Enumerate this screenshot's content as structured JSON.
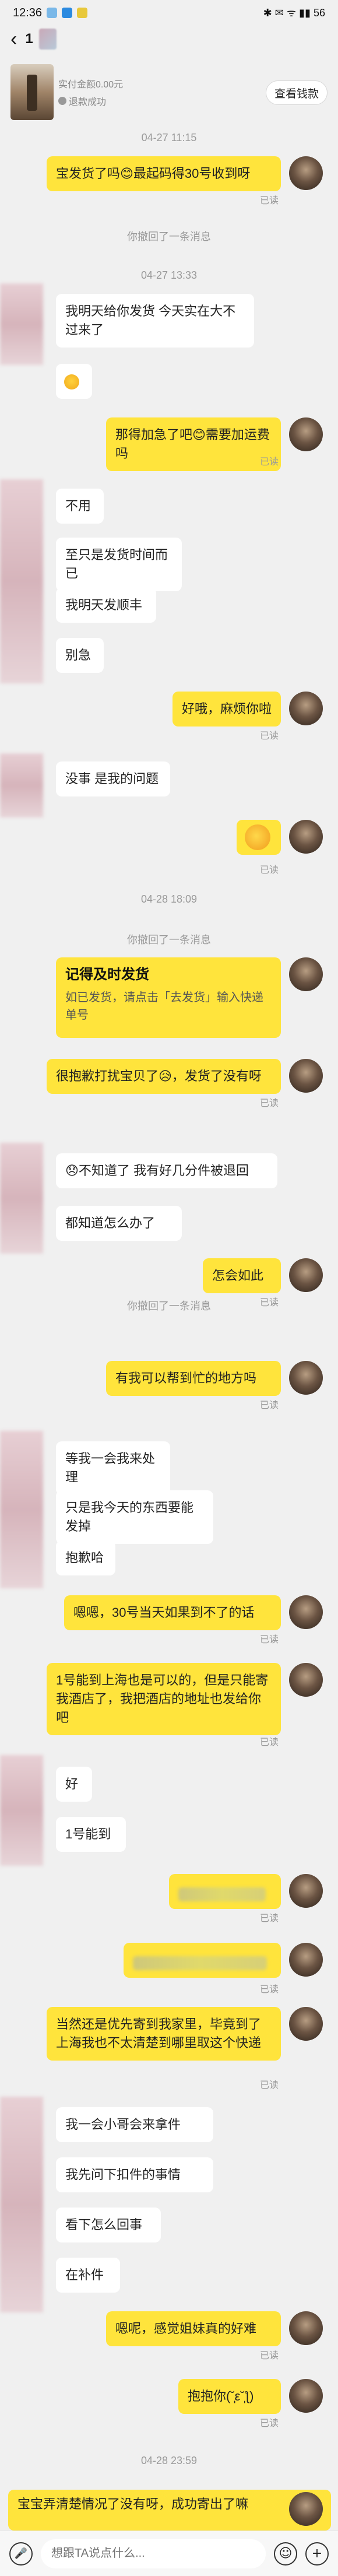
{
  "status_bar": {
    "time": "12:36",
    "indicators": "✱ ✉ ᯤ ▮▮ 56"
  },
  "header": {
    "back_glyph": "‹",
    "title": "1"
  },
  "order": {
    "price": "实付金额0.00元",
    "status": "退款成功",
    "button": "查看钱款"
  },
  "messages": [
    {
      "kind": "ts",
      "text": "04-27 11:15"
    },
    {
      "kind": "out",
      "text": "宝发货了吗😊最起码得30号收到呀",
      "read": "已读"
    },
    {
      "kind": "sys",
      "text": "你撤回了一条消息"
    },
    {
      "kind": "ts",
      "text": "04-27 13:33"
    },
    {
      "kind": "in",
      "text": "我明天给你发货 今天实在大不过来了"
    },
    {
      "kind": "in",
      "text": "😞"
    },
    {
      "kind": "out",
      "text": "那得加急了吧😊需要加运费吗",
      "read": "已读"
    },
    {
      "kind": "in",
      "text": "不用"
    },
    {
      "kind": "in",
      "text": "至只是发货时间而已"
    },
    {
      "kind": "in",
      "text": "我明天发顺丰"
    },
    {
      "kind": "in",
      "text": "别急"
    },
    {
      "kind": "out",
      "text": "好哦，麻烦你啦",
      "read": "已读"
    },
    {
      "kind": "in",
      "text": "没事 是我的问题"
    },
    {
      "kind": "out",
      "text": "😉",
      "read": "已读"
    },
    {
      "kind": "ts",
      "text": "04-28 18:09"
    },
    {
      "kind": "sys",
      "text": "你撤回了一条消息"
    },
    {
      "kind": "card",
      "title": "记得及时发货",
      "sub": "如已发货，请点击「去发货」输入快递单号"
    },
    {
      "kind": "out",
      "text": "很抱歉打扰宝贝了😥，发货了没有呀",
      "read": "已读"
    },
    {
      "kind": "in",
      "text": "😞不知道了 我有好几分件被退回"
    },
    {
      "kind": "in",
      "text": "都知道怎么办了"
    },
    {
      "kind": "out",
      "text": "怎会如此",
      "read": "已读"
    },
    {
      "kind": "sys",
      "text": "你撤回了一条消息"
    },
    {
      "kind": "out",
      "text": "有我可以帮到忙的地方吗",
      "read": "已读"
    },
    {
      "kind": "in",
      "text": "等我一会我来处理"
    },
    {
      "kind": "in",
      "text": "只是我今天的东西要能发掉"
    },
    {
      "kind": "in",
      "text": "抱歉哈"
    },
    {
      "kind": "out",
      "text": "嗯嗯，30号当天如果到不了的话",
      "read": "已读"
    },
    {
      "kind": "out",
      "text": "1号能到上海也是可以的，但是只能寄我酒店了，我把酒店的地址也发给你吧",
      "read": "已读"
    },
    {
      "kind": "in",
      "text": "好"
    },
    {
      "kind": "in",
      "text": "1号能到"
    },
    {
      "kind": "out",
      "text": "",
      "read": "已读"
    },
    {
      "kind": "out",
      "text": "",
      "read": "已读"
    },
    {
      "kind": "out",
      "text": "当然还是优先寄到我家里，毕竟到了上海我也不太清楚到哪里取这个快递",
      "read": "已读"
    },
    {
      "kind": "in",
      "text": "我一会小哥会来拿件"
    },
    {
      "kind": "in",
      "text": "我先问下扣件的事情"
    },
    {
      "kind": "in",
      "text": "看下怎么回事"
    },
    {
      "kind": "in",
      "text": "在补件"
    },
    {
      "kind": "out",
      "text": "嗯呢，感觉姐妹真的好难",
      "read": "已读"
    },
    {
      "kind": "out",
      "text": "抱抱你(˘̩̩̩ε˘̩ƪ)",
      "read": "已读"
    },
    {
      "kind": "ts",
      "text": "04-28 23:59"
    }
  ],
  "compose": {
    "text": "宝宝弄清楚情况了没有呀，成功寄出了嘛"
  },
  "input_bar": {
    "placeholder": "想跟TA说点什么..."
  }
}
